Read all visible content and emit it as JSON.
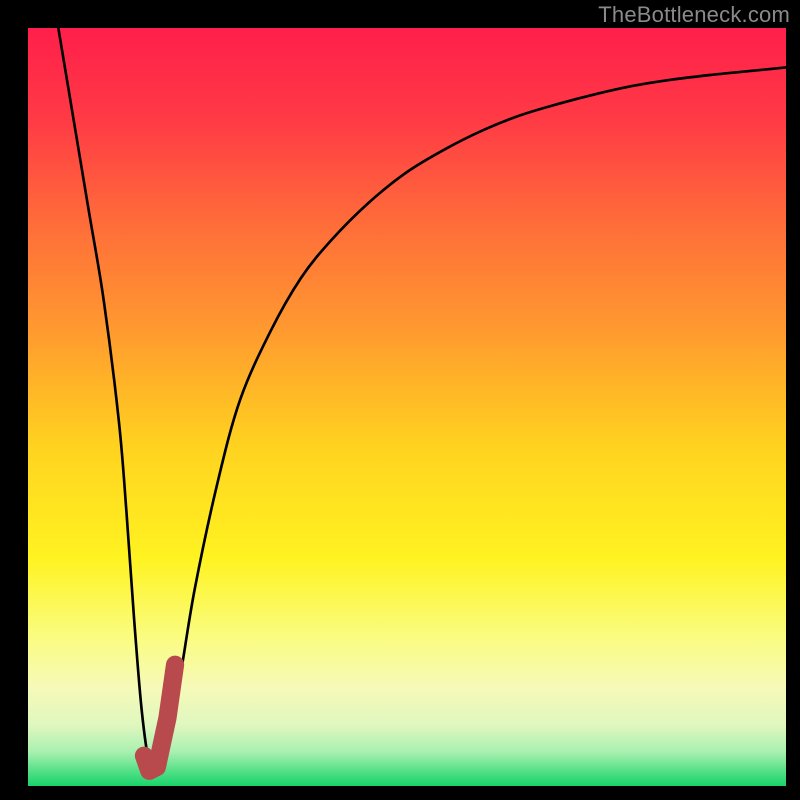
{
  "watermark": "TheBottleneck.com",
  "colors": {
    "frame": "#000000",
    "curve_stroke": "#000000",
    "marker_stroke": "#b8494c",
    "gradient_stops": [
      {
        "offset": 0.0,
        "color": "#ff1f4b"
      },
      {
        "offset": 0.12,
        "color": "#ff3a45"
      },
      {
        "offset": 0.25,
        "color": "#ff6a3a"
      },
      {
        "offset": 0.4,
        "color": "#ff9a2f"
      },
      {
        "offset": 0.55,
        "color": "#ffd21f"
      },
      {
        "offset": 0.7,
        "color": "#fff321"
      },
      {
        "offset": 0.8,
        "color": "#fafc7d"
      },
      {
        "offset": 0.87,
        "color": "#f6fab8"
      },
      {
        "offset": 0.92,
        "color": "#dff7bf"
      },
      {
        "offset": 0.955,
        "color": "#a9f0b0"
      },
      {
        "offset": 0.98,
        "color": "#55e087"
      },
      {
        "offset": 1.0,
        "color": "#17d36b"
      }
    ]
  },
  "chart_data": {
    "type": "line",
    "title": "",
    "xlabel": "",
    "ylabel": "",
    "xlim": [
      0,
      100
    ],
    "ylim": [
      0,
      100
    ],
    "series": [
      {
        "name": "bottleneck-curve",
        "x": [
          4,
          6,
          8,
          10,
          12,
          13,
          14,
          15,
          16,
          17,
          18,
          20,
          22,
          25,
          28,
          32,
          36,
          40,
          45,
          50,
          55,
          60,
          65,
          70,
          75,
          80,
          85,
          90,
          95,
          100
        ],
        "y": [
          100,
          88,
          76,
          64,
          48,
          36,
          22,
          10,
          3,
          2,
          4,
          14,
          26,
          40,
          51,
          60,
          67,
          72,
          77,
          81,
          84,
          86.5,
          88.5,
          90,
          91.3,
          92.4,
          93.2,
          93.8,
          94.3,
          94.8
        ]
      }
    ],
    "marker": {
      "name": "highlight-segment",
      "points": [
        {
          "x": 15.3,
          "y": 4
        },
        {
          "x": 16.0,
          "y": 2
        },
        {
          "x": 17.0,
          "y": 2.5
        },
        {
          "x": 18.4,
          "y": 9
        },
        {
          "x": 19.4,
          "y": 16
        }
      ]
    }
  }
}
